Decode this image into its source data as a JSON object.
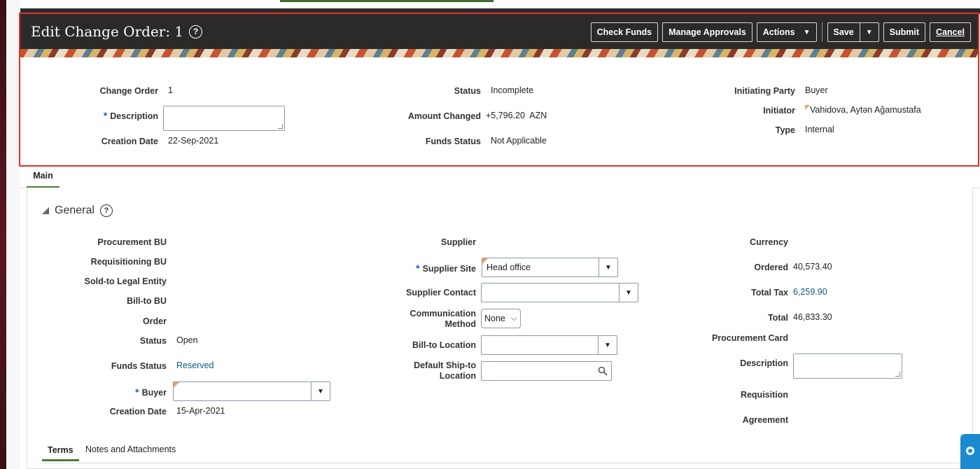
{
  "header": {
    "title": "Edit Change Order: 1",
    "help": "?",
    "buttons": {
      "check_funds": "Check Funds",
      "manage_approvals": "Manage Approvals",
      "actions": "Actions",
      "save": "Save",
      "submit": "Submit",
      "cancel": "Cancel"
    }
  },
  "change_order": {
    "change_order_label": "Change Order",
    "change_order_value": "1",
    "description_label": "Description",
    "creation_date_label": "Creation Date",
    "creation_date_value": "22-Sep-2021",
    "status_label": "Status",
    "status_value": "Incomplete",
    "amount_changed_label": "Amount Changed",
    "amount_changed_value": "+5,796.20",
    "amount_currency": "AZN",
    "funds_status_label": "Funds Status",
    "funds_status_value": "Not Applicable",
    "initiating_party_label": "Initiating Party",
    "initiating_party_value": "Buyer",
    "initiator_label": "Initiator",
    "initiator_value": "Vahidova, Aytən Ağamustafa",
    "type_label": "Type",
    "type_value": "Internal"
  },
  "tabs": {
    "main": "Main"
  },
  "general": {
    "title": "General",
    "help": "?",
    "col1": {
      "procurement_bu": "Procurement BU",
      "requisitioning_bu": "Requisitioning BU",
      "sold_to": "Sold-to Legal Entity",
      "bill_to_bu": "Bill-to BU",
      "order": "Order",
      "status_label": "Status",
      "status_value": "Open",
      "funds_status_label": "Funds Status",
      "funds_status_value": "Reserved",
      "buyer_label": "Buyer",
      "creation_date_label": "Creation Date",
      "creation_date_value": "15-Apr-2021"
    },
    "col2": {
      "supplier": "Supplier",
      "supplier_site_label": "Supplier Site",
      "supplier_site_value": "Head office",
      "supplier_contact": "Supplier Contact",
      "comm_method_line1": "Communication",
      "comm_method_line2": "Method",
      "comm_method_value": "None",
      "bill_to_location": "Bill-to Location",
      "ship_to_line1": "Default Ship-to",
      "ship_to_line2": "Location"
    },
    "col3": {
      "currency": "Currency",
      "ordered_label": "Ordered",
      "ordered_value": "40,573.40",
      "total_tax_label": "Total Tax",
      "total_tax_value": "6,259.90",
      "total_label": "Total",
      "total_value": "46,833.30",
      "procurement_card": "Procurement Card",
      "description_label": "Description",
      "requisition": "Requisition",
      "agreement": "Agreement"
    }
  },
  "subtabs": {
    "terms": "Terms",
    "notes": "Notes and Attachments"
  }
}
